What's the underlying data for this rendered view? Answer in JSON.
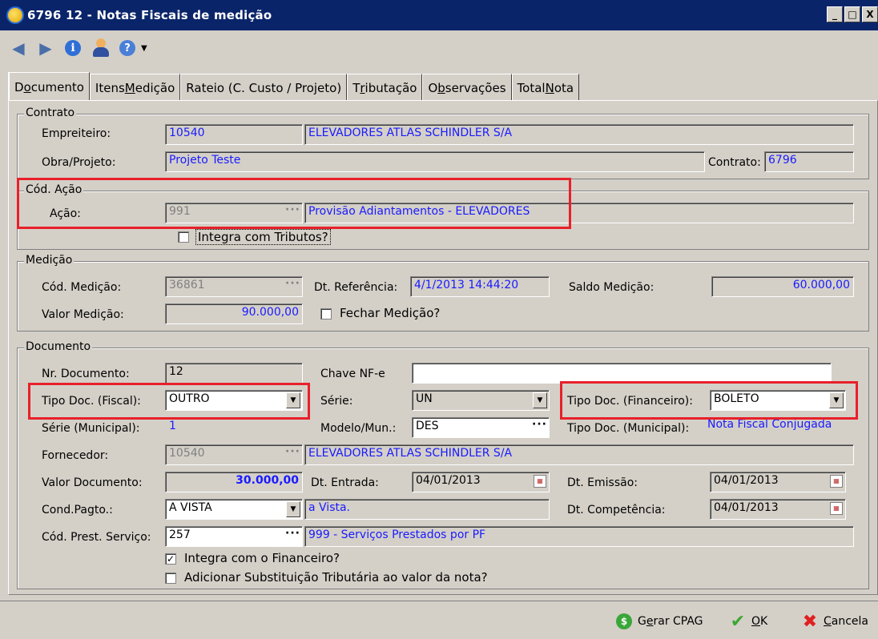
{
  "window": {
    "title": "6796 12 - Notas Fiscais de medição",
    "min": "_",
    "max": "□",
    "close": "X"
  },
  "toolbar": {
    "back": "◀",
    "forward": "▶",
    "info": "i",
    "help": "?",
    "drop": "▼"
  },
  "tabs": [
    {
      "pre": "D",
      "ul": "o",
      "post": "cumento"
    },
    {
      "pre": "Itens ",
      "ul": "M",
      "post": "edição"
    },
    {
      "pre": "Rateio (C. Custo / Projeto)",
      "ul": "",
      "post": ""
    },
    {
      "pre": "T",
      "ul": "r",
      "post": "ibutação"
    },
    {
      "pre": "O",
      "ul": "b",
      "post": "servações"
    },
    {
      "pre": "Total ",
      "ul": "N",
      "post": "ota"
    }
  ],
  "contrato": {
    "legend": "Contrato",
    "empreiteiro_label": "Empreiteiro:",
    "empreiteiro_code": "10540",
    "empreiteiro_name": "ELEVADORES ATLAS SCHINDLER S/A",
    "obra_label": "Obra/Projeto:",
    "obra_value": "Projeto Teste",
    "contrato_label": "Contrato:",
    "contrato_value": "6796"
  },
  "acao": {
    "legend": "Cód. Ação",
    "label": "Ação:",
    "code": "991",
    "ellipsis": "···",
    "name": "Provisão Adiantamentos - ELEVADORES",
    "integra_tributos": "Integra com Tributos?"
  },
  "medicao": {
    "legend": "Medição",
    "cod_label": "Cód. Medição:",
    "cod_value": "36861",
    "dt_ref_label": "Dt. Referência:",
    "dt_ref_value": "4/1/2013 14:44:20",
    "saldo_label": "Saldo Medição:",
    "saldo_value": "60.000,00",
    "valor_label": "Valor Medição:",
    "valor_value": "90.000,00",
    "fechar_label": "Fechar Medição?"
  },
  "documento": {
    "legend": "Documento",
    "nr_label": "Nr. Documento:",
    "nr_value": "12",
    "chave_label": "Chave NF-e",
    "chave_value": "",
    "tipo_fiscal_label": "Tipo Doc. (Fiscal):",
    "tipo_fiscal_value": "OUTRO",
    "serie_label": "Série:",
    "serie_value": "UN",
    "tipo_fin_label": "Tipo Doc. (Financeiro):",
    "tipo_fin_value": "BOLETO",
    "serie_mun_label": "Série (Municipal):",
    "serie_mun_value": "1",
    "modelo_label": "Modelo/Mun.:",
    "modelo_value": "DES",
    "tipo_mun_label": "Tipo Doc. (Municipal):",
    "tipo_mun_value": "Nota Fiscal Conjugada",
    "fornecedor_label": "Fornecedor:",
    "fornecedor_code": "10540",
    "fornecedor_name": "ELEVADORES ATLAS SCHINDLER S/A",
    "valor_label": "Valor Documento:",
    "valor_value": "30.000,00",
    "dt_entrada_label": "Dt. Entrada:",
    "dt_entrada_value": "04/01/2013",
    "dt_emissao_label": "Dt. Emissão:",
    "dt_emissao_value": "04/01/2013",
    "cond_label": "Cond.Pagto.:",
    "cond_value": "A VISTA",
    "cond_desc": "a Vista.",
    "dt_comp_label": "Dt. Competência:",
    "dt_comp_value": "04/01/2013",
    "prest_label": "Cód. Prest. Serviço:",
    "prest_value": "257",
    "prest_desc": "999 - Serviços Prestados por PF",
    "integra_fin": "Integra com o Financeiro?",
    "adicionar_st": "Adicionar Substituição Tributária ao valor da nota?"
  },
  "footer": {
    "gerar_pre": "G",
    "gerar_ul": "e",
    "gerar_post": "rar CPAG",
    "ok_ul": "O",
    "ok_post": "K",
    "cancel_ul": "C",
    "cancel_post": "ancela"
  },
  "colors": {
    "highlight": "#e8202a",
    "link_blue": "#1a1aff",
    "titlebar": "#0a246a"
  }
}
